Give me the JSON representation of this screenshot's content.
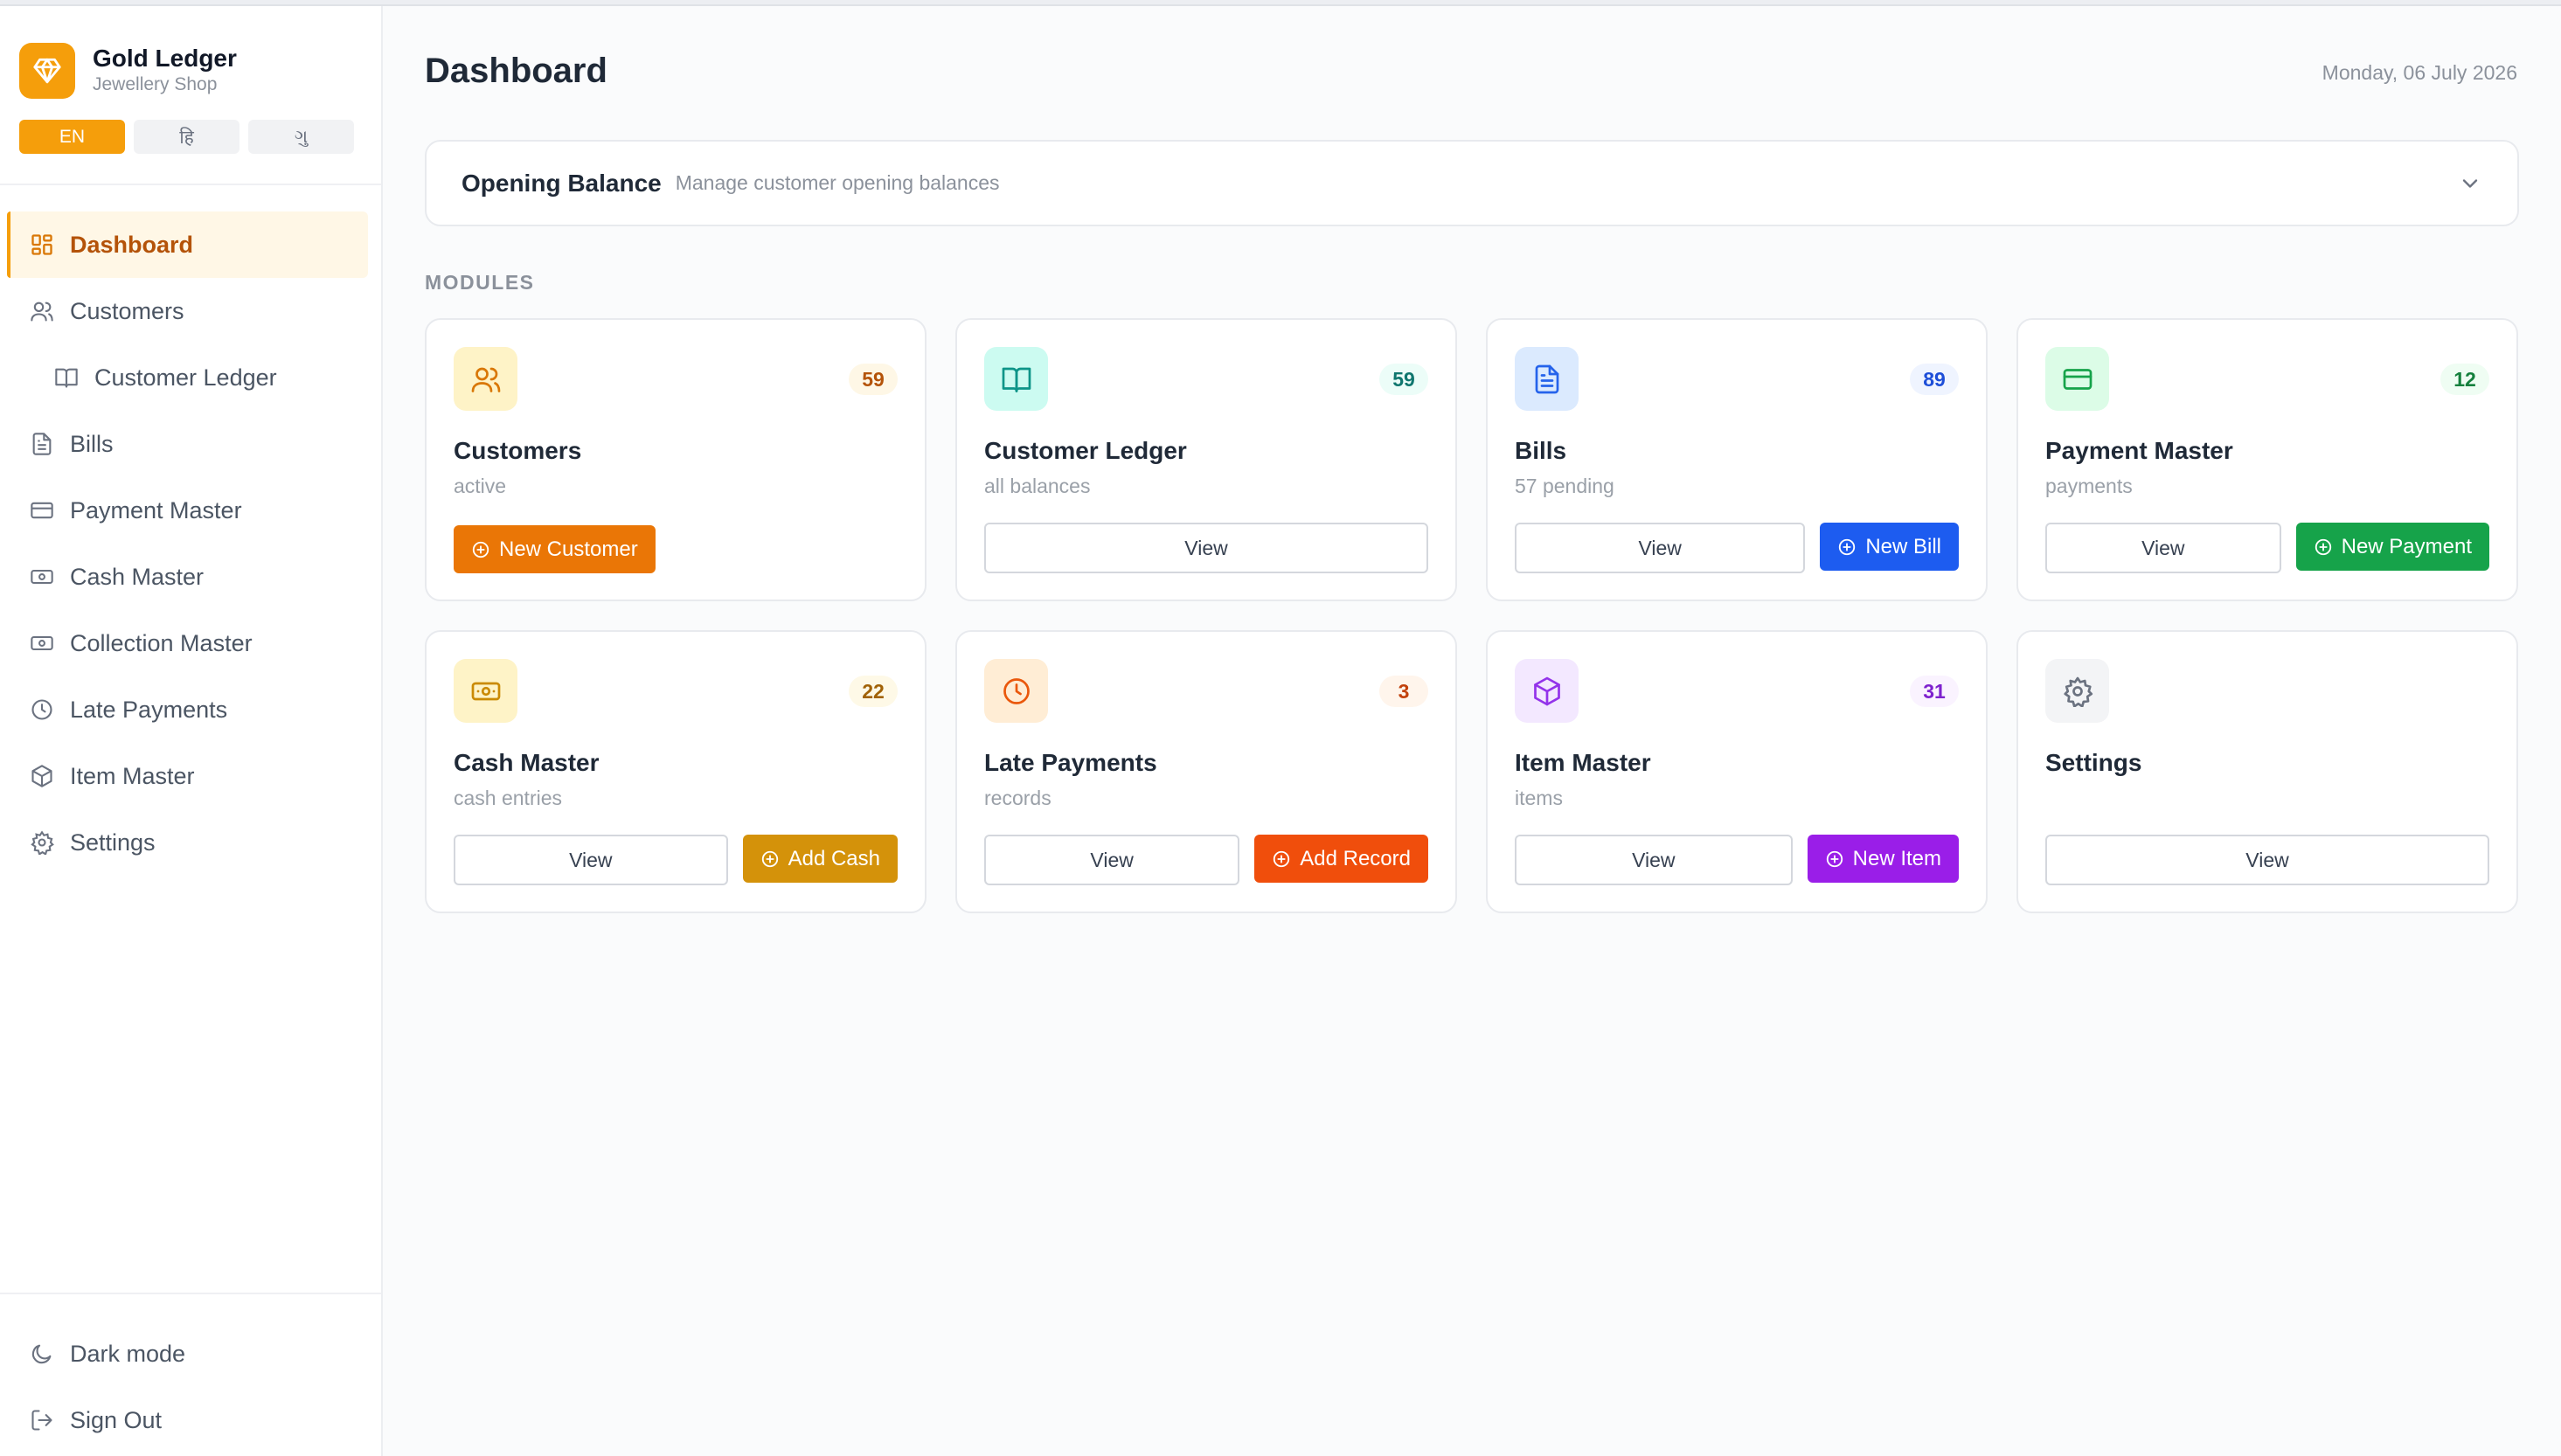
{
  "brand": {
    "name": "Gold Ledger",
    "subtitle": "Jewellery Shop"
  },
  "languages": [
    {
      "label": "EN",
      "active": true
    },
    {
      "label": "हि",
      "active": false
    },
    {
      "label": "ગુ",
      "active": false
    }
  ],
  "sidebar": {
    "items": [
      {
        "label": "Dashboard",
        "icon": "grid-icon",
        "active": true
      },
      {
        "label": "Customers",
        "icon": "users-icon"
      },
      {
        "label": "Customer Ledger",
        "icon": "book-icon",
        "sub": true
      },
      {
        "label": "Bills",
        "icon": "file-icon"
      },
      {
        "label": "Payment Master",
        "icon": "card-icon"
      },
      {
        "label": "Cash Master",
        "icon": "cash-icon"
      },
      {
        "label": "Collection Master",
        "icon": "cash-icon"
      },
      {
        "label": "Late Payments",
        "icon": "clock-icon"
      },
      {
        "label": "Item Master",
        "icon": "box-icon"
      },
      {
        "label": "Settings",
        "icon": "gear-icon"
      }
    ],
    "bottom": [
      {
        "label": "Dark mode",
        "icon": "moon-icon"
      },
      {
        "label": "Sign Out",
        "icon": "logout-icon"
      }
    ]
  },
  "header": {
    "title": "Dashboard",
    "date": "Monday, 06 July 2026"
  },
  "opening_balance": {
    "title": "Opening Balance",
    "subtitle": "Manage customer opening balances"
  },
  "modules_label": "MODULES",
  "modules": [
    {
      "title": "Customers",
      "subtitle": "active",
      "count": "59",
      "icon": "users-icon",
      "icon_bg": "#fef3c7",
      "icon_color": "#d97706",
      "count_bg": "#fef7e6",
      "count_color": "#b45309",
      "view": "",
      "action": "New Customer",
      "action_color": "#ea7606"
    },
    {
      "title": "Customer Ledger",
      "subtitle": "all balances",
      "count": "59",
      "icon": "book-icon",
      "icon_bg": "#ccfbf1",
      "icon_color": "#0d9488",
      "count_bg": "#ecfdf8",
      "count_color": "#0f766e",
      "view": "View",
      "action": "",
      "action_color": ""
    },
    {
      "title": "Bills",
      "subtitle": "57 pending",
      "count": "89",
      "icon": "file-icon",
      "icon_bg": "#dbeafe",
      "icon_color": "#2563eb",
      "count_bg": "#eff4ff",
      "count_color": "#1d4ed8",
      "view": "View",
      "action": "New Bill",
      "action_color": "#1d5cf0"
    },
    {
      "title": "Payment Master",
      "subtitle": "payments",
      "count": "12",
      "icon": "card-icon",
      "icon_bg": "#dcfce7",
      "icon_color": "#16a34a",
      "count_bg": "#effdf3",
      "count_color": "#15803d",
      "view": "View",
      "action": "New Payment",
      "action_color": "#16a34a"
    },
    {
      "title": "Cash Master",
      "subtitle": "cash entries",
      "count": "22",
      "icon": "cash-icon",
      "icon_bg": "#fef3c7",
      "icon_color": "#ca8a04",
      "count_bg": "#fef9e7",
      "count_color": "#a16207",
      "view": "View",
      "action": "Add Cash",
      "action_color": "#d4920a"
    },
    {
      "title": "Late Payments",
      "subtitle": "records",
      "count": "3",
      "icon": "clock-icon",
      "icon_bg": "#ffedd5",
      "icon_color": "#ea580c",
      "count_bg": "#fff5ec",
      "count_color": "#c2410c",
      "view": "View",
      "action": "Add Record",
      "action_color": "#f04e0c"
    },
    {
      "title": "Item Master",
      "subtitle": "items",
      "count": "31",
      "icon": "box-icon",
      "icon_bg": "#f3e8ff",
      "icon_color": "#9333ea",
      "count_bg": "#faf3ff",
      "count_color": "#7e22ce",
      "view": "View",
      "action": "New Item",
      "action_color": "#9a1ee8"
    },
    {
      "title": "Settings",
      "subtitle": "",
      "count": "",
      "icon": "gear-icon",
      "icon_bg": "#f3f4f6",
      "icon_color": "#6b7280",
      "count_bg": "",
      "count_color": "",
      "view": "View",
      "action": "",
      "action_color": ""
    }
  ]
}
